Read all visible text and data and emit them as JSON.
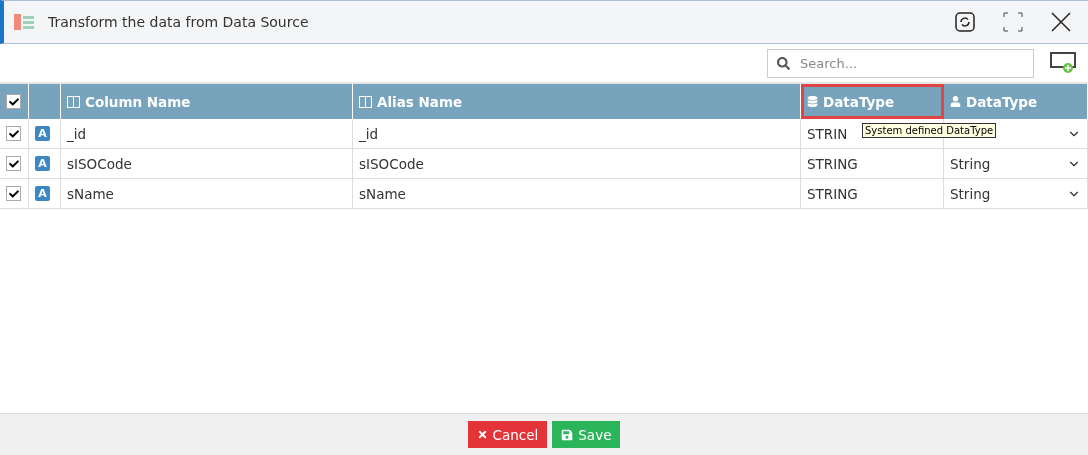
{
  "window": {
    "title": "Transform the data from Data Source"
  },
  "search": {
    "placeholder": "Search..."
  },
  "table": {
    "all_checked": true,
    "columns": [
      {
        "label": "Column Name",
        "kind": "column",
        "highlighted": false
      },
      {
        "label": "Alias Name",
        "kind": "column",
        "highlighted": false
      },
      {
        "label": "DataType",
        "kind": "system",
        "highlighted": true
      },
      {
        "label": "DataType",
        "kind": "user",
        "highlighted": false
      }
    ],
    "rows": [
      {
        "checked": true,
        "type_badge": "A",
        "column_name": "_id",
        "alias_name": "_id",
        "system_type": "STRIN"
      },
      {
        "checked": true,
        "type_badge": "A",
        "column_name": "sISOCode",
        "alias_name": "sISOCode",
        "system_type": "STRING",
        "user_type": "String"
      },
      {
        "checked": true,
        "type_badge": "A",
        "column_name": "sName",
        "alias_name": "sName",
        "system_type": "STRING",
        "user_type": "String"
      }
    ]
  },
  "tooltip": "System defined DataType",
  "buttons": [
    {
      "label": "Cancel",
      "kind": "cancel"
    },
    {
      "label": "Save",
      "kind": "save"
    }
  ]
}
